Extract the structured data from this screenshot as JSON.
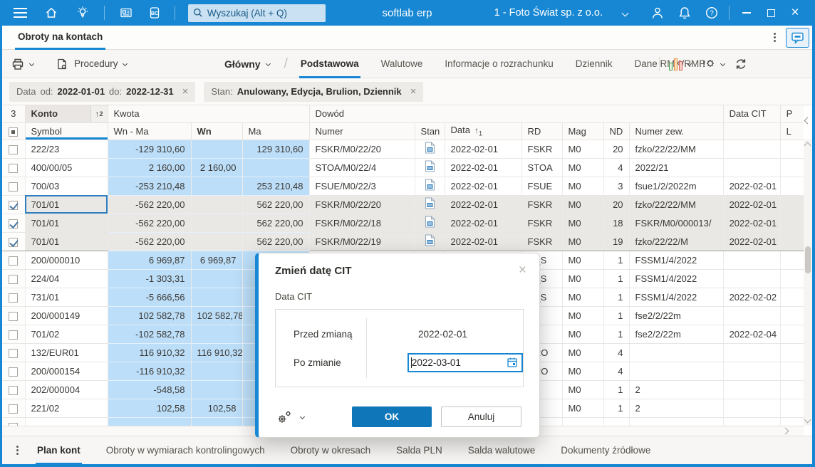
{
  "topbar": {
    "search_placeholder": "Wyszukaj (Alt + Q)",
    "app_name": "softlab erp",
    "company": "1 - Foto Świat sp. z o.o."
  },
  "window_tab": {
    "title": "Obroty na kontach"
  },
  "toolbar": {
    "procedures_label": "Procedury",
    "layout_label": "Główny",
    "view_tabs": [
      {
        "label": "Podstawowa",
        "active": true
      },
      {
        "label": "Walutowe",
        "active": false
      },
      {
        "label": "Informacje o rozrachunku",
        "active": false
      },
      {
        "label": "Dziennik",
        "active": false
      },
      {
        "label": "Dane RMK/RMP",
        "active": false
      }
    ]
  },
  "filters": {
    "date": {
      "name": "Data",
      "from_key": "od:",
      "from": "2022-01-01",
      "to_key": "do:",
      "to": "2022-12-31"
    },
    "state": {
      "name": "Stan:",
      "value": "Anulowany, Edycja, Brulion, Dziennik"
    }
  },
  "table": {
    "count": "3",
    "groups": {
      "konto": "Konto",
      "kwota": "Kwota",
      "dowod": "Dowód",
      "datacit": "Data CIT",
      "p": "P",
      "l": "L"
    },
    "headers": {
      "symbol": "Symbol",
      "wnma": "Wn - Ma",
      "wn": "Wn",
      "ma": "Ma",
      "numer": "Numer",
      "stan": "Stan",
      "data": "Data",
      "rd": "RD",
      "mag": "Mag",
      "nd": "ND",
      "numerzew": "Numer zew."
    },
    "sort": {
      "konto": "2",
      "data": "1"
    },
    "rows": [
      {
        "checked": false,
        "selected": false,
        "current": false,
        "focus": false,
        "icon": true,
        "symbol": "222/23",
        "wnma": "-129 310,60",
        "wn": "",
        "ma": "129 310,60",
        "numer": "FSKR/M0/22/20",
        "data": "2022-02-01",
        "rd": "FSKR",
        "mag": "M0",
        "nd": "20",
        "numerzew": "fzko/22/22/MM",
        "datacit": ""
      },
      {
        "checked": false,
        "selected": false,
        "current": false,
        "focus": false,
        "icon": true,
        "symbol": "400/00/05",
        "wnma": "2 160,00",
        "wn": "2 160,00",
        "ma": "",
        "numer": "STOA/M0/22/4",
        "data": "2022-02-01",
        "rd": "STOA",
        "mag": "M0",
        "nd": "4",
        "numerzew": "2022/21",
        "datacit": ""
      },
      {
        "checked": false,
        "selected": false,
        "current": false,
        "focus": false,
        "icon": true,
        "symbol": "700/03",
        "wnma": "-253 210,48",
        "wn": "",
        "ma": "253 210,48",
        "numer": "FSUE/M0/22/3",
        "data": "2022-02-01",
        "rd": "FSUE",
        "mag": "M0",
        "nd": "3",
        "numerzew": "fsue1/2/2022m",
        "datacit": "2022-02-01"
      },
      {
        "checked": true,
        "selected": true,
        "current": false,
        "focus": true,
        "icon": true,
        "symbol": "701/01",
        "wnma": "-562 220,00",
        "wn": "",
        "ma": "562 220,00",
        "numer": "FSKR/M0/22/20",
        "data": "2022-02-01",
        "rd": "FSKR",
        "mag": "M0",
        "nd": "20",
        "numerzew": "fzko/22/22/MM",
        "datacit": "2022-02-01"
      },
      {
        "checked": true,
        "selected": true,
        "current": false,
        "focus": false,
        "icon": true,
        "symbol": "701/01",
        "wnma": "-562 220,00",
        "wn": "",
        "ma": "562 220,00",
        "numer": "FSKR/M0/22/18",
        "data": "2022-02-01",
        "rd": "FSKR",
        "mag": "M0",
        "nd": "18",
        "numerzew": "FSKR/M0/000013/",
        "datacit": "2022-02-01"
      },
      {
        "checked": true,
        "selected": true,
        "current": true,
        "focus": false,
        "icon": true,
        "symbol": "701/01",
        "wnma": "-562 220,00",
        "wn": "",
        "ma": "562 220,00",
        "numer": "FSKR/M0/22/19",
        "data": "2022-02-01",
        "rd": "FSKR",
        "mag": "M0",
        "nd": "19",
        "numerzew": "fzko/22/22/M",
        "datacit": "2022-02-01"
      },
      {
        "checked": false,
        "selected": false,
        "current": false,
        "focus": false,
        "icon": false,
        "symbol": "200/000010",
        "wnma": "6 969,87",
        "wn": "6 969,87",
        "ma": "",
        "numer": "",
        "data": "",
        "rd": "M_S",
        "mag": "M0",
        "nd": "1",
        "numerzew": "FSSM1/4/2022",
        "datacit": ""
      },
      {
        "checked": false,
        "selected": false,
        "current": false,
        "focus": false,
        "icon": false,
        "symbol": "224/04",
        "wnma": "-1 303,31",
        "wn": "",
        "ma": "",
        "numer": "",
        "data": "",
        "rd": "M_S",
        "mag": "M0",
        "nd": "1",
        "numerzew": "FSSM1/4/2022",
        "datacit": ""
      },
      {
        "checked": false,
        "selected": false,
        "current": false,
        "focus": false,
        "icon": false,
        "symbol": "731/01",
        "wnma": "-5 666,56",
        "wn": "",
        "ma": "",
        "numer": "",
        "data": "",
        "rd": "M_S",
        "mag": "M0",
        "nd": "1",
        "numerzew": "FSSM1/4/2022",
        "datacit": "2022-02-02"
      },
      {
        "checked": false,
        "selected": false,
        "current": false,
        "focus": false,
        "icon": false,
        "symbol": "200/000149",
        "wnma": "102 582,78",
        "wn": "102 582,78",
        "ma": "",
        "numer": "",
        "data": "",
        "rd": "",
        "mag": "M0",
        "nd": "1",
        "numerzew": "fse2/2/22m",
        "datacit": ""
      },
      {
        "checked": false,
        "selected": false,
        "current": false,
        "focus": false,
        "icon": false,
        "symbol": "701/02",
        "wnma": "-102 582,78",
        "wn": "",
        "ma": "",
        "numer": "",
        "data": "",
        "rd": "",
        "mag": "M0",
        "nd": "1",
        "numerzew": "fse2/2/22m",
        "datacit": "2022-02-04"
      },
      {
        "checked": false,
        "selected": false,
        "current": false,
        "focus": false,
        "icon": false,
        "symbol": "132/EUR01",
        "wnma": "116 910,32",
        "wn": "116 910,32",
        "ma": "",
        "numer": "",
        "data": "",
        "rd": "URO",
        "mag": "M0",
        "nd": "4",
        "numerzew": "",
        "datacit": ""
      },
      {
        "checked": false,
        "selected": false,
        "current": false,
        "focus": false,
        "icon": false,
        "symbol": "200/000154",
        "wnma": "-116 910,32",
        "wn": "",
        "ma": "",
        "numer": "",
        "data": "",
        "rd": "URO",
        "mag": "M0",
        "nd": "4",
        "numerzew": "",
        "datacit": ""
      },
      {
        "checked": false,
        "selected": false,
        "current": false,
        "focus": false,
        "icon": false,
        "symbol": "202/000004",
        "wnma": "-548,58",
        "wn": "",
        "ma": "",
        "numer": "",
        "data": "",
        "rd": "",
        "mag": "M0",
        "nd": "1",
        "numerzew": "2",
        "datacit": ""
      },
      {
        "checked": false,
        "selected": false,
        "current": false,
        "focus": false,
        "icon": false,
        "symbol": "221/02",
        "wnma": "102,58",
        "wn": "102,58",
        "ma": "",
        "numer": "",
        "data": "",
        "rd": "",
        "mag": "M0",
        "nd": "1",
        "numerzew": "2",
        "datacit": ""
      },
      {
        "checked": false,
        "selected": false,
        "current": false,
        "focus": false,
        "icon": false,
        "symbol": "",
        "wnma": "",
        "wn": "",
        "ma": "",
        "numer": "",
        "data": "",
        "rd": "",
        "mag": "",
        "nd": "",
        "numerzew": "",
        "datacit": ""
      }
    ]
  },
  "modal": {
    "title": "Zmień datę CIT",
    "field_label": "Data CIT",
    "before_label": "Przed zmianą",
    "before_value": "2022-02-01",
    "after_label": "Po zmianie",
    "after_value": "2022-03-01",
    "ok_label": "OK",
    "cancel_label": "Anuluj"
  },
  "bottom_tabs": [
    {
      "label": "Plan kont",
      "active": true
    },
    {
      "label": "Obroty w wymiarach kontrolingowych",
      "active": false
    },
    {
      "label": "Obroty w okresach",
      "active": false
    },
    {
      "label": "Salda PLN",
      "active": false
    },
    {
      "label": "Salda walutowe",
      "active": false
    },
    {
      "label": "Dokumenty źródłowe",
      "active": false
    }
  ],
  "colors": {
    "accent": "#1787d3",
    "ok_button": "#0f76ba",
    "amount_highlight": "#bcdef8",
    "selection": "#eae8e5"
  }
}
